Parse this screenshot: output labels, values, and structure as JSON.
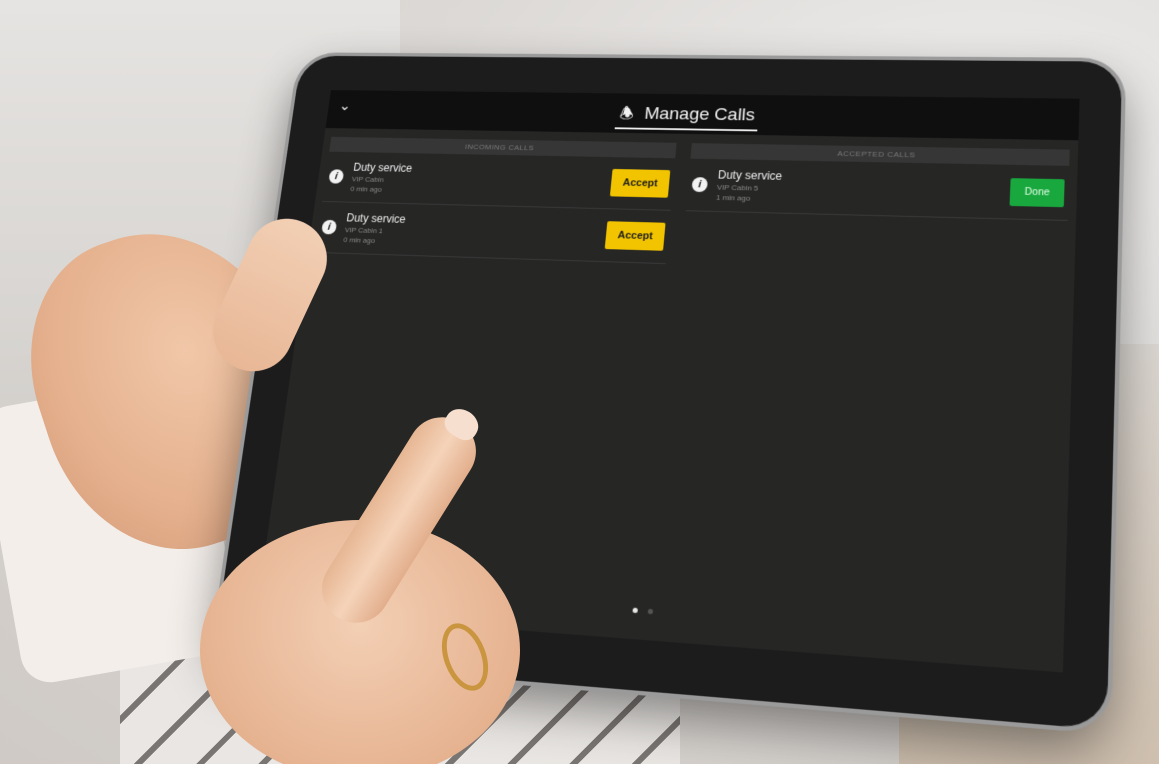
{
  "app": {
    "title": "Manage Calls",
    "back_icon": "chevron-down-icon",
    "title_icon": "bell-icon"
  },
  "incoming": {
    "header": "INCOMING CALLS",
    "calls": [
      {
        "title": "Duty service",
        "location": "VIP Cabin",
        "time": "0 min ago",
        "button": "Accept"
      },
      {
        "title": "Duty service",
        "location": "VIP Cabin 1",
        "time": "0 min ago",
        "button": "Accept"
      }
    ]
  },
  "accepted": {
    "header": "ACCEPTED CALLS",
    "calls": [
      {
        "title": "Duty service",
        "location": "VIP Cabin 5",
        "time": "1 min ago",
        "button": "Done"
      }
    ]
  },
  "pager": {
    "total": 2,
    "active": 1
  },
  "colors": {
    "accept": "#f2c400",
    "done": "#19a83e",
    "screen_bg": "#262625"
  }
}
